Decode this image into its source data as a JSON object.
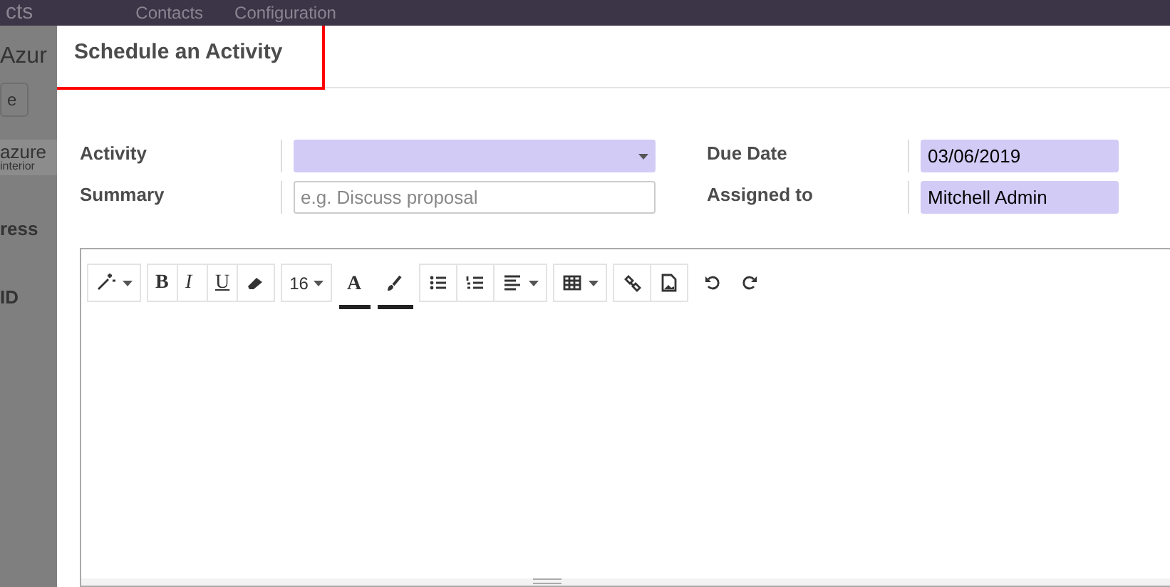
{
  "background": {
    "app_title": "cts",
    "menu": [
      "Contacts",
      "Configuration"
    ],
    "record_title": "Azur",
    "button": "e",
    "logo": {
      "name": "azure",
      "tagline": "interior"
    },
    "labels": [
      "ress",
      "ID"
    ]
  },
  "dialog": {
    "title": "Schedule an Activity",
    "highlighted": true,
    "fields": [
      {
        "label": "Activity",
        "kind": "select",
        "required": true
      },
      {
        "label": "Due Date",
        "kind": "text",
        "value": "03/06/2019",
        "required": true
      },
      {
        "label": "Summary",
        "kind": "text",
        "placeholder": "e.g. Discuss proposal",
        "required": false
      },
      {
        "label": "Assigned to",
        "kind": "text",
        "value": "Mitchell Admin",
        "required": true
      }
    ],
    "toolbar": [
      {
        "framed": true,
        "items": [
          {
            "kind": "wand",
            "dropdown": true
          }
        ]
      },
      {
        "framed": true,
        "items": [
          {
            "kind": "bold",
            "label": "B",
            "dropdown": false
          },
          {
            "kind": "italic",
            "label": "I",
            "dropdown": false
          },
          {
            "kind": "underline",
            "label": "U",
            "dropdown": false
          },
          {
            "kind": "eraser",
            "dropdown": false
          }
        ]
      },
      {
        "framed": true,
        "items": [
          {
            "kind": "text",
            "label": "16",
            "dropdown": true
          }
        ]
      },
      {
        "framed": false,
        "items": [
          {
            "kind": "font-color",
            "label": "A",
            "dropdown": false
          }
        ]
      },
      {
        "framed": false,
        "items": [
          {
            "kind": "brush",
            "dropdown": false
          }
        ]
      },
      {
        "framed": true,
        "items": [
          {
            "kind": "bullet-list",
            "dropdown": false
          },
          {
            "kind": "number-list",
            "dropdown": false
          },
          {
            "kind": "align",
            "dropdown": true
          }
        ]
      },
      {
        "framed": true,
        "items": [
          {
            "kind": "table",
            "dropdown": true
          }
        ]
      },
      {
        "framed": true,
        "items": [
          {
            "kind": "link",
            "dropdown": false
          },
          {
            "kind": "image",
            "dropdown": false
          }
        ]
      },
      {
        "framed": false,
        "items": [
          {
            "kind": "undo",
            "dropdown": false
          },
          {
            "kind": "redo",
            "dropdown": false
          }
        ]
      }
    ]
  }
}
